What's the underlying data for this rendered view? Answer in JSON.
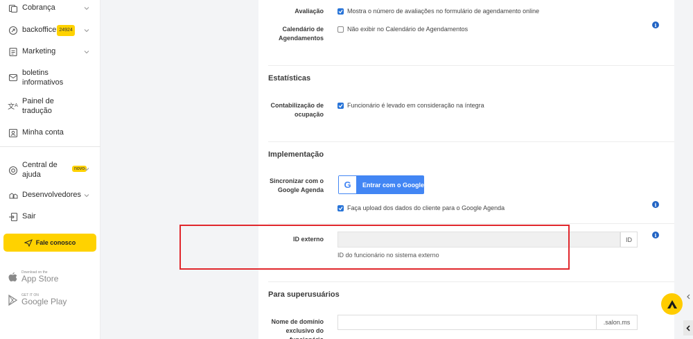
{
  "sidebar": {
    "items": [
      {
        "label": "Cobrança",
        "icon": "billing-icon",
        "has_chevron": true
      },
      {
        "label": "backoffice",
        "badge": "24924",
        "icon": "backoffice-icon",
        "has_chevron": true
      },
      {
        "label": "Marketing",
        "icon": "marketing-icon",
        "has_chevron": true
      },
      {
        "label": "boletins informativos",
        "icon": "mail-icon",
        "has_chevron": false
      },
      {
        "label": "Painel de tradução",
        "icon": "translate-icon",
        "has_chevron": false
      },
      {
        "label": "Minha conta",
        "icon": "account-icon",
        "has_chevron": false
      },
      {
        "label": "Central de ajuda",
        "badge": "novo",
        "icon": "lifebuoy-icon",
        "has_chevron": true
      },
      {
        "label": "Desenvolvedores",
        "icon": "developers-icon",
        "has_chevron": true
      },
      {
        "label": "Sair",
        "icon": "logout-icon",
        "has_chevron": false
      }
    ],
    "contact_button": "Fale conosco",
    "app_store": {
      "small": "Download on the",
      "big": "App Store"
    },
    "google_play": {
      "small": "GET IT ON",
      "big": "Google Play"
    }
  },
  "settings": {
    "avaliacao": {
      "label": "Avaliação",
      "checkbox": "Mostra o número de avaliações no formulário de agendamento online",
      "checked": true
    },
    "calendario": {
      "label": "Calendário de Agendamentos",
      "checkbox": "Não exibir no Calendário de Agendamentos",
      "checked": false
    },
    "estatisticas": {
      "title": "Estatísticas",
      "label": "Contabilização de ocupação",
      "checkbox": "Funcionário é levado em consideração na íntegra",
      "checked": true
    },
    "implementacao": {
      "title": "Implementação",
      "label": "Sincronizar com o Google Agenda",
      "google_button": "Entrar com o Google",
      "google_letter": "G",
      "checkbox": "Faça upload dos dados do cliente para o Google Agenda",
      "checked": true
    },
    "id_externo": {
      "label": "ID externo",
      "value": "",
      "suffix": "ID",
      "helper": "ID do funcionário no sistema externo"
    },
    "superusuarios": {
      "title": "Para superusuários",
      "label": "Nome de domínio exclusivo do funcionário",
      "value": "",
      "suffix": ".salon.ms"
    }
  },
  "colors": {
    "accent": "#ffd200",
    "checkbox": "#2874d8",
    "info": "#2264c4",
    "google": "#4286f4",
    "highlight": "#e0262b"
  }
}
